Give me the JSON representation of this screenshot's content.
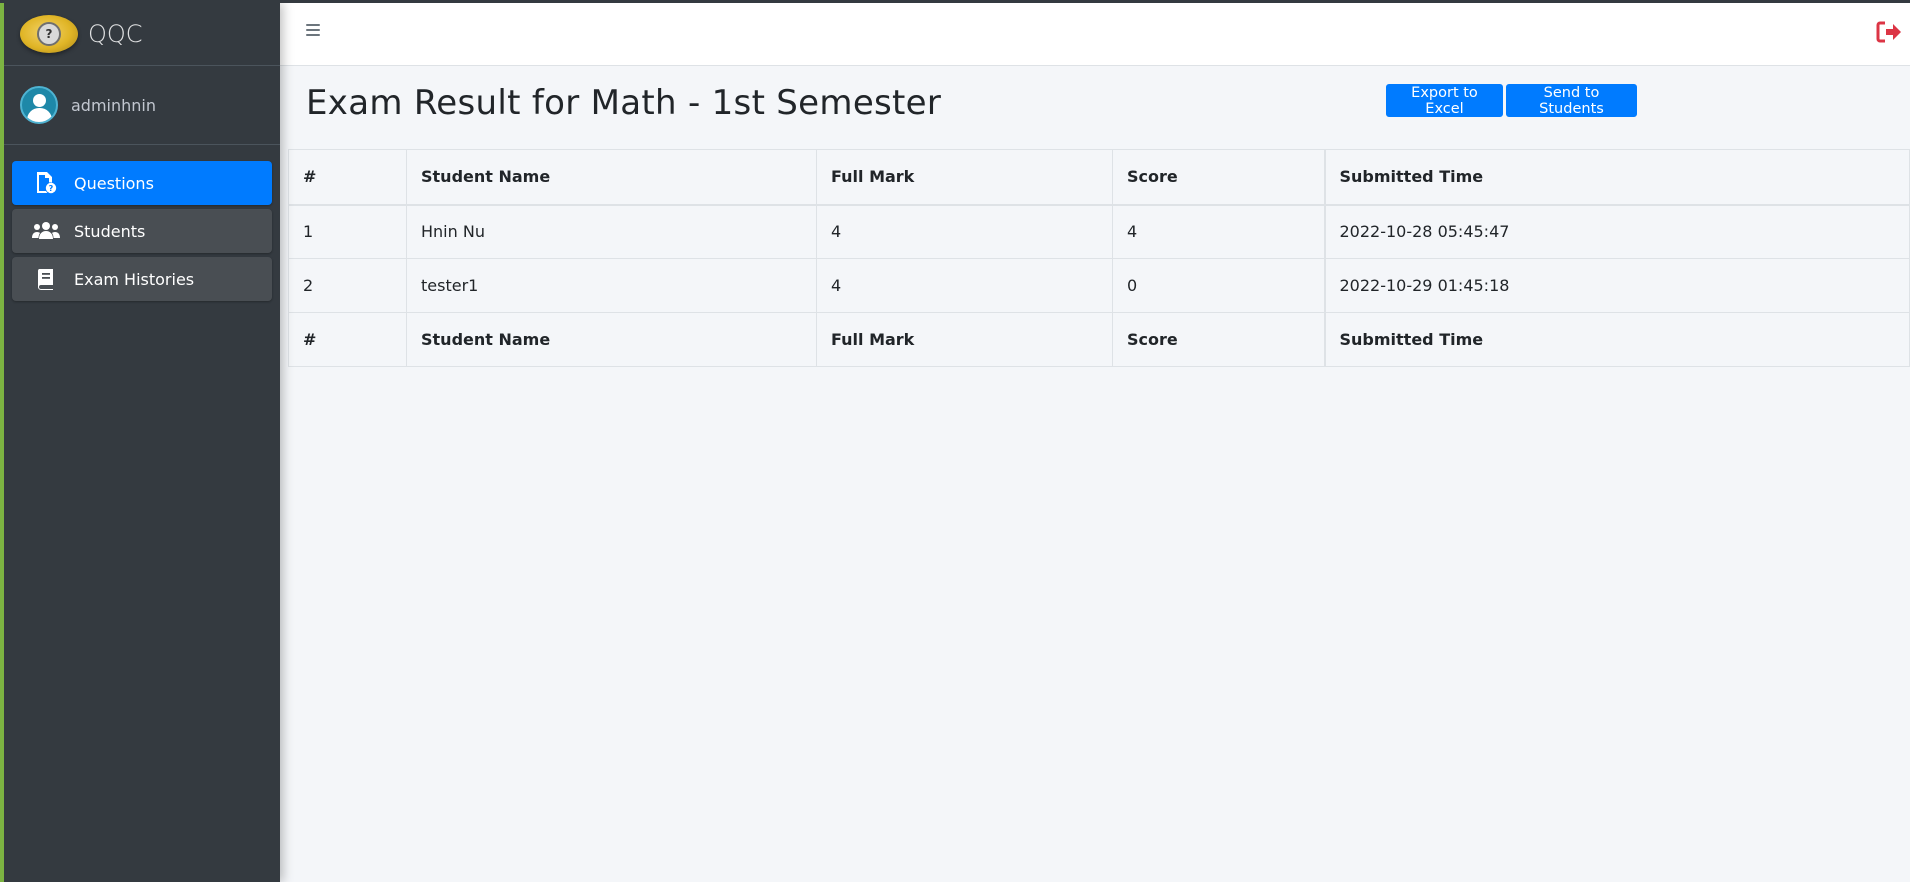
{
  "brand": {
    "name": "QQC",
    "logo_icon": "question-mark-coin-logo"
  },
  "user": {
    "name": "adminhnin",
    "avatar_icon": "user-avatar-icon"
  },
  "sidebar": {
    "items": [
      {
        "label": "Questions",
        "icon": "file-question-icon",
        "active": true
      },
      {
        "label": "Students",
        "icon": "users-icon",
        "active": false
      },
      {
        "label": "Exam Histories",
        "icon": "book-icon",
        "active": false
      }
    ]
  },
  "topbar": {
    "menu_icon": "hamburger-icon",
    "logout_icon": "sign-out-icon"
  },
  "page": {
    "title": "Exam Result for Math - 1st Semester",
    "export_label": "Export to Excel",
    "send_label": "Send to Students"
  },
  "table": {
    "headers": [
      "#",
      "Student Name",
      "Full Mark",
      "Score",
      "Submitted Time"
    ],
    "rows": [
      [
        "1",
        "Hnin Nu",
        "4",
        "4",
        "2022-10-28 05:45:47"
      ],
      [
        "2",
        "tester1",
        "4",
        "0",
        "2022-10-29 01:45:18"
      ]
    ],
    "footers": [
      "#",
      "Student Name",
      "Full Mark",
      "Score",
      "Submitted Time"
    ]
  },
  "colors": {
    "primary": "#007bff",
    "sidebar": "#343a40",
    "logout": "#dc3545"
  }
}
